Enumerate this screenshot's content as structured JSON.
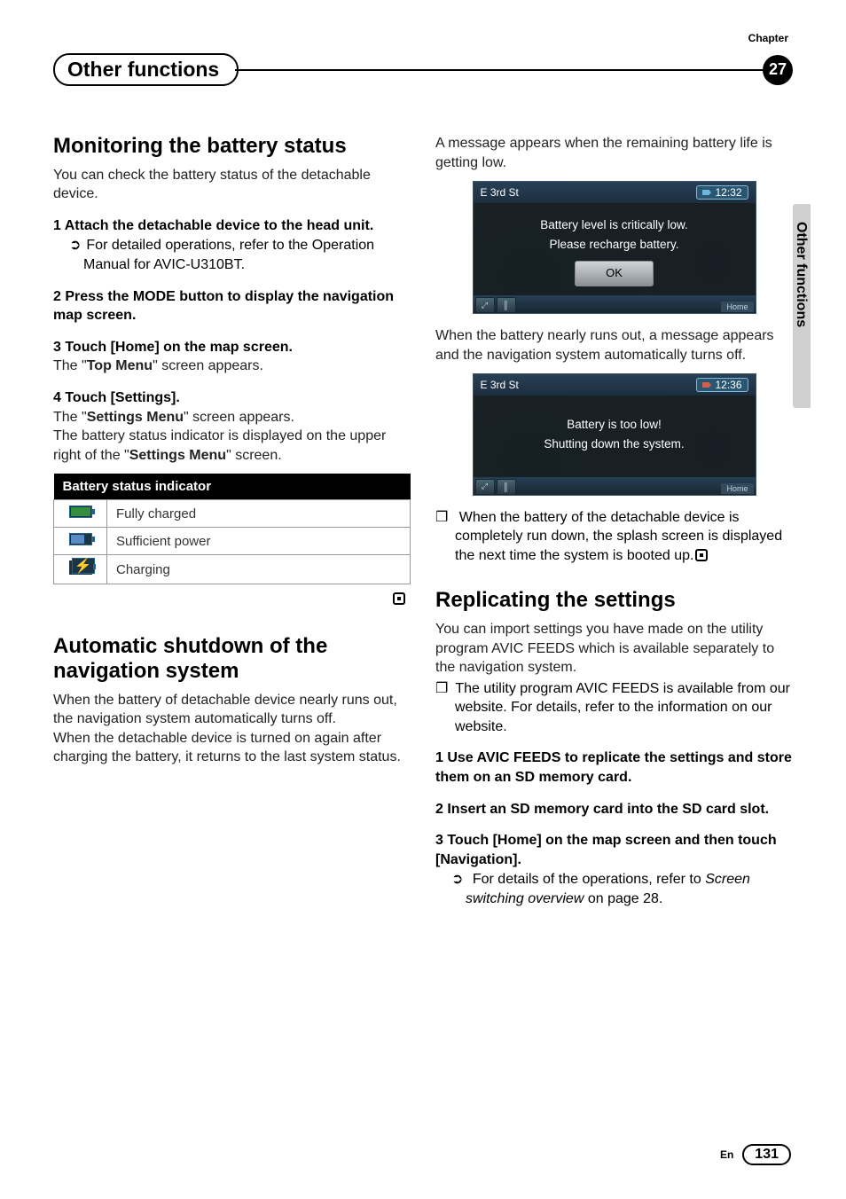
{
  "header": {
    "chapter_label": "Chapter",
    "title": "Other functions",
    "chapter_number": "27",
    "side_tab": "Other functions"
  },
  "left": {
    "sec1_h": "Monitoring the battery status",
    "sec1_intro": "You can check the battery status of the detachable device.",
    "sec1_step1_lead": "1    Attach the detachable device to the head unit.",
    "sec1_step1_sub": "For detailed operations, refer to the Operation Manual for AVIC-U310BT.",
    "sec1_step2_lead": "2    Press the MODE button to display the navigation map screen.",
    "sec1_step3_lead": "3    Touch [Home] on the map screen.",
    "sec1_step3_body_a": "The \"",
    "sec1_step3_body_b": "Top Menu",
    "sec1_step3_body_c": "\" screen appears.",
    "sec1_step4_lead": "4    Touch [Settings].",
    "sec1_step4_body1_a": "The \"",
    "sec1_step4_body1_b": "Settings Menu",
    "sec1_step4_body1_c": "\" screen appears.",
    "sec1_step4_body2_a": "The battery status indicator is displayed on the upper right of the \"",
    "sec1_step4_body2_b": "Settings Menu",
    "sec1_step4_body2_c": "\" screen.",
    "table_header": "Battery status indicator",
    "table_r1": "Fully charged",
    "table_r2": "Sufficient power",
    "table_r3": "Charging",
    "sec2_h": "Automatic shutdown of the navigation system",
    "sec2_body1": "When the battery of detachable device nearly runs out, the navigation system automatically turns off.",
    "sec2_body2": "When the detachable device is turned on again after charging the battery, it returns to the last system status."
  },
  "right": {
    "intro1": "A message appears when the remaining battery life is getting low.",
    "shot1_loc": "E 3rd St",
    "shot1_time": "12:32",
    "shot1_l1": "Battery level is critically low.",
    "shot1_l2": "Please recharge battery.",
    "shot1_ok": "OK",
    "shot_home": "Home",
    "between": "When the battery nearly runs out, a message appears and the navigation system automatically turns off.",
    "shot2_loc": "E 3rd St",
    "shot2_time": "12:36",
    "shot2_l1": "Battery is too low!",
    "shot2_l2": "Shutting down the system.",
    "note1": "When the battery of the detachable device is completely run down, the splash screen is displayed the next time the system is booted up.",
    "sec3_h": "Replicating the settings",
    "sec3_body": "You can import settings you have made on the utility program AVIC FEEDS which is available separately to the navigation system.",
    "sec3_note": "The utility program AVIC FEEDS is available from our website. For details, refer to the information on our website.",
    "sec3_step1": "1    Use AVIC FEEDS to replicate the settings and store them on an SD memory card.",
    "sec3_step2": "2    Insert an SD memory card into the SD card slot.",
    "sec3_step3": "3    Touch [Home] on the map screen and then touch [Navigation].",
    "sec3_step3_sub_a": "For details of the operations, refer to ",
    "sec3_step3_sub_b": "Screen switching overview",
    "sec3_step3_sub_c": " on page 28."
  },
  "footer": {
    "lang": "En",
    "page": "131"
  }
}
